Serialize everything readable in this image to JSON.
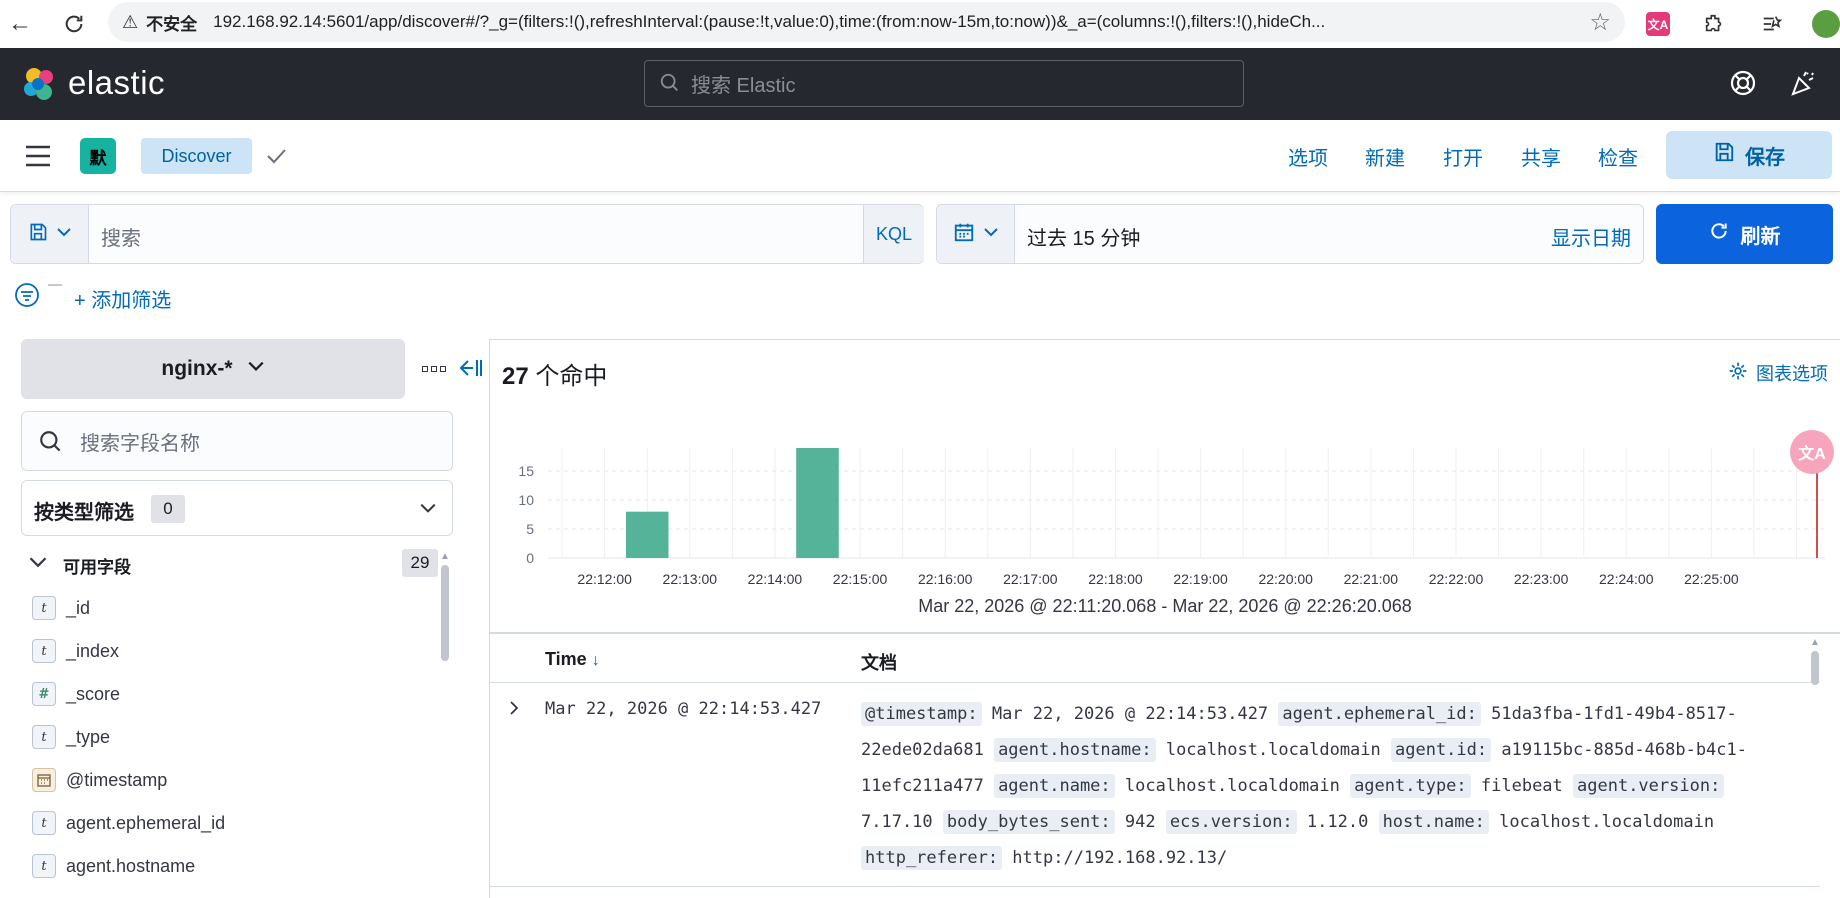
{
  "browser": {
    "insecure_label": "不安全",
    "url": "192.168.92.14:5601/app/discover#/?_g=(filters:!(),refreshInterval:(pause:!t,value:0),time:(from:now-15m,to:now))&_a=(columns:!(),filters:!(),hideCh..."
  },
  "header": {
    "logo": "elastic",
    "search_placeholder": "搜索 Elastic"
  },
  "app_bar": {
    "space_badge": "默",
    "app_name": "Discover",
    "links": [
      "选项",
      "新建",
      "打开",
      "共享",
      "检查"
    ],
    "save_label": "保存"
  },
  "query": {
    "placeholder": "搜索",
    "language": "KQL"
  },
  "date": {
    "range": "过去 15 分钟",
    "show_dates": "显示日期",
    "refresh_label": "刷新"
  },
  "filters": {
    "add_filter": "+ 添加筛选"
  },
  "sidebar": {
    "index_pattern": "nginx-*",
    "field_search_placeholder": "搜索字段名称",
    "type_filter_label": "按类型筛选",
    "type_filter_count": "0",
    "available_fields_label": "可用字段",
    "available_fields_count": "29",
    "fields": [
      {
        "name": "_id",
        "type": "t"
      },
      {
        "name": "_index",
        "type": "t"
      },
      {
        "name": "_score",
        "type": "#"
      },
      {
        "name": "_type",
        "type": "t"
      },
      {
        "name": "@timestamp",
        "type": "date"
      },
      {
        "name": "agent.ephemeral_id",
        "type": "t"
      },
      {
        "name": "agent.hostname",
        "type": "t"
      }
    ]
  },
  "hits": {
    "count": "27",
    "label": "个命中",
    "chart_options": "图表选项"
  },
  "chart_data": {
    "type": "bar",
    "x": [
      "22:12:00",
      "22:13:00",
      "22:14:00",
      "22:15:00",
      "22:16:00",
      "22:17:00",
      "22:18:00",
      "22:19:00",
      "22:20:00",
      "22:21:00",
      "22:22:00",
      "22:23:00",
      "22:24:00",
      "22:25:00"
    ],
    "bars": [
      {
        "x": "22:12:30",
        "value": 8
      },
      {
        "x": "22:14:30",
        "value": 19
      }
    ],
    "yticks": [
      0,
      5,
      10,
      15
    ],
    "ylim": [
      0,
      19
    ],
    "range_label": "Mar 22, 2026 @ 22:11:20.068 - Mar 22, 2026 @ 22:26:20.068",
    "bar_color": "#54b399"
  },
  "table": {
    "col_time": "Time",
    "col_doc": "文档",
    "row": {
      "time": "Mar 22, 2026 @ 22:14:53.427",
      "pairs": [
        {
          "k": "@timestamp:",
          "v": "Mar 22, 2026 @ 22:14:53.427"
        },
        {
          "k": "agent.ephemeral_id:",
          "v": "51da3fba-1fd1-49b4-8517-22ede02da681"
        },
        {
          "k": "agent.hostname:",
          "v": "localhost.localdomain"
        },
        {
          "k": "agent.id:",
          "v": "a19115bc-885d-468b-b4c1-11efc211a477"
        },
        {
          "k": "agent.name:",
          "v": "localhost.localdomain"
        },
        {
          "k": "agent.type:",
          "v": "filebeat"
        },
        {
          "k": "agent.version:",
          "v": "7.17.10"
        },
        {
          "k": "body_bytes_sent:",
          "v": "942"
        },
        {
          "k": "ecs.version:",
          "v": "1.12.0"
        },
        {
          "k": "host.name:",
          "v": "localhost.localdomain"
        },
        {
          "k": "http_referer:",
          "v": "http://192.168.92.13/"
        }
      ]
    }
  }
}
